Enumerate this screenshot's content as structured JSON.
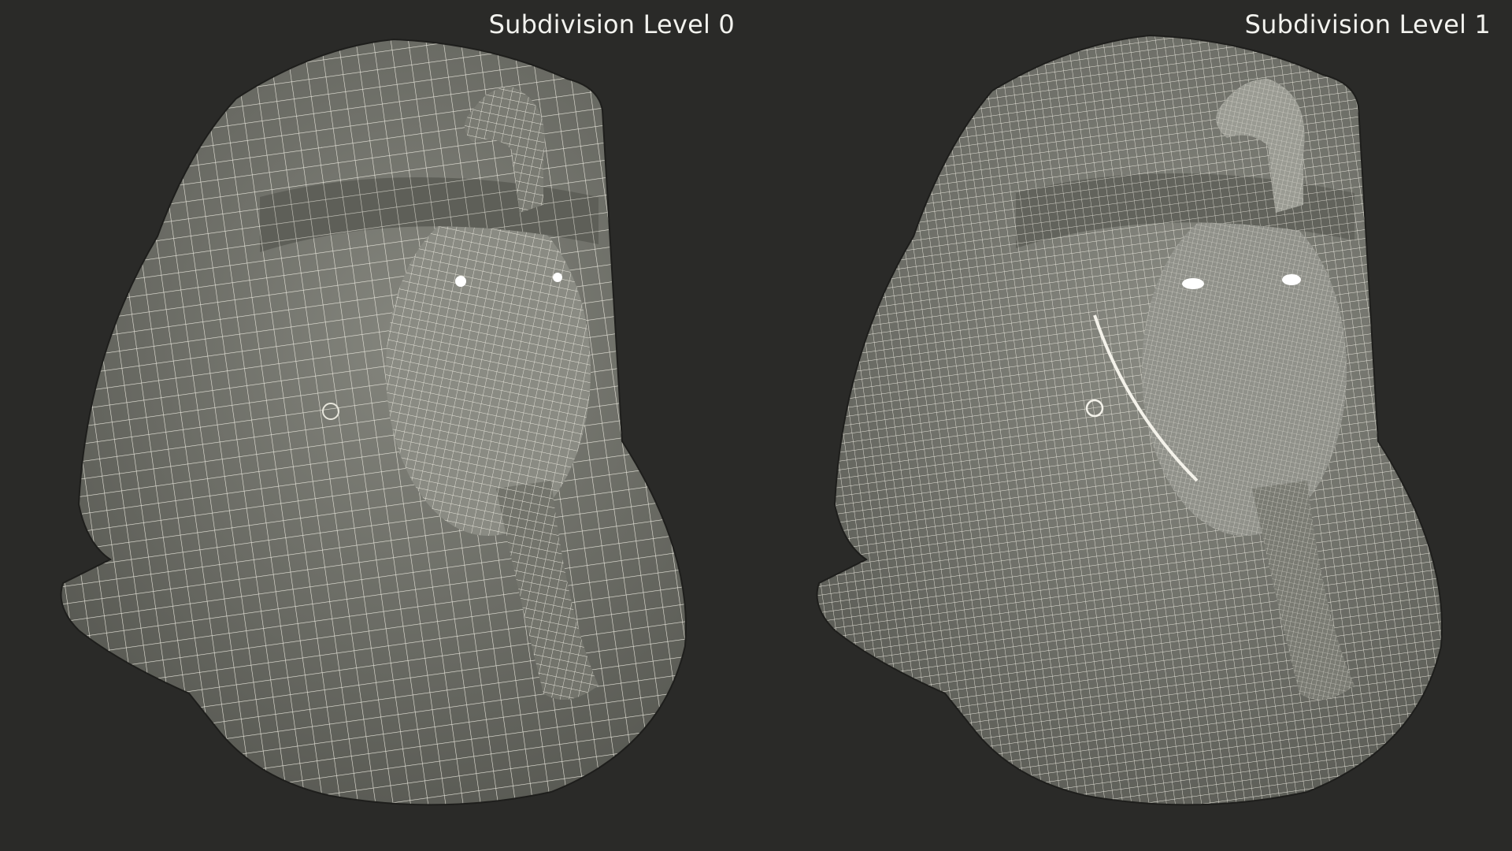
{
  "viewport": {
    "background": "#2a2a28",
    "mesh_fill": "#6e6f68",
    "wire_color": "#e8e6dc"
  },
  "panels": [
    {
      "label": "Subdivision Level 0",
      "subdivision": 0
    },
    {
      "label": "Subdivision Level 1",
      "subdivision": 1
    }
  ]
}
